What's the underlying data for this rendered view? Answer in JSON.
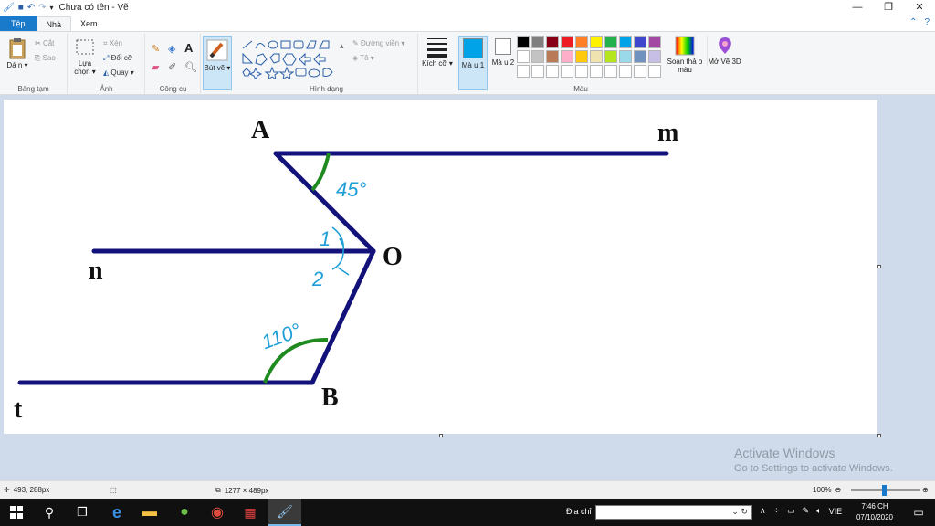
{
  "titlebar": {
    "title": "Chưa có tên - Vẽ",
    "min_label": "—",
    "max_label": "❐",
    "close_label": "✕"
  },
  "tabs": [
    {
      "label": "Tệp"
    },
    {
      "label": "Nhà"
    },
    {
      "label": "Xem"
    }
  ],
  "ribbon": {
    "clipboard": {
      "paste": "Dá n ▾",
      "cut": "Cắt",
      "copy": "Sao",
      "group": "Bảng tạm"
    },
    "image": {
      "select": "Lựa chọn ▾",
      "crop": "Xén",
      "resize": "Đổi cỡ",
      "rotate": "Quay ▾",
      "group": "Ảnh"
    },
    "tools": {
      "group": "Công cụ"
    },
    "brushes": {
      "label": "Bút vẽ ▾"
    },
    "shapes": {
      "outline": "Đường viền ▾",
      "fill": "Tô ▾",
      "group": "Hình dạng"
    },
    "size": {
      "label": "Kích cỡ ▾"
    },
    "color1": {
      "label": "Mà u 1"
    },
    "color2": {
      "label": "Mà u 2"
    },
    "colors_group": "Màu",
    "edit_colors": "Soạn thả o màu",
    "paint3d": "Mở Vẽ 3D"
  },
  "palette": {
    "row1": [
      "#000000",
      "#7f7f7f",
      "#880015",
      "#ed1c24",
      "#ff7f27",
      "#fff200",
      "#22b14c",
      "#00a2e8",
      "#3f48cc",
      "#a349a4"
    ],
    "row2": [
      "#ffffff",
      "#c3c3c3",
      "#b97a57",
      "#ffaec9",
      "#ffc90e",
      "#efe4b0",
      "#b5e61d",
      "#99d9ea",
      "#7092be",
      "#c8bfe7"
    ],
    "row3": [
      "#ffffff",
      "#ffffff",
      "#ffffff",
      "#ffffff",
      "#ffffff",
      "#ffffff",
      "#ffffff",
      "#ffffff",
      "#ffffff",
      "#ffffff"
    ],
    "color1": "#00a2e8",
    "color2": "#ffffff"
  },
  "drawing": {
    "labels": {
      "A": "A",
      "m": "m",
      "n": "n",
      "O": "O",
      "t": "t",
      "B": "B"
    },
    "annot_45": "45°",
    "annot_1": "1",
    "annot_2": "2",
    "annot_110": "110°",
    "line_color": "#12127a",
    "arc_color": "#1f8a1f",
    "ink_color": "#1f9ed8"
  },
  "watermark": {
    "line1": "Activate Windows",
    "line2": "Go to Settings to activate Windows."
  },
  "status": {
    "cursor": "493, 288px",
    "size": "1277 × 489px",
    "zoom": "100%"
  },
  "taskbar": {
    "address_label": "Địa chỉ",
    "lang": "VIE",
    "time": "7:46 CH",
    "date": "07/10/2020"
  }
}
